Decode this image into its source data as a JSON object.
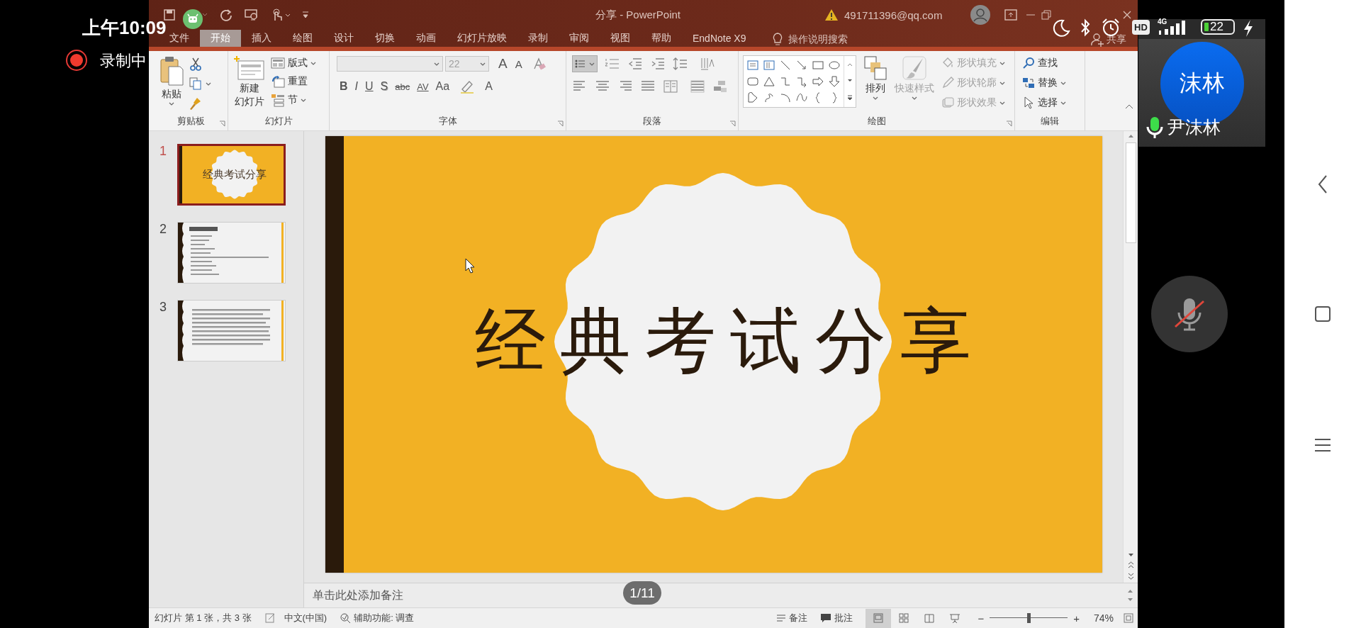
{
  "phone_status": {
    "time": "上午10:09",
    "recording": "录制中"
  },
  "title_bar": {
    "document_title": "分享  -  PowerPoint",
    "account": "491711396@qq.com"
  },
  "menu_tabs": [
    {
      "label": "文件",
      "selected": false
    },
    {
      "label": "开始",
      "selected": true
    },
    {
      "label": "插入",
      "selected": false
    },
    {
      "label": "绘图",
      "selected": false
    },
    {
      "label": "设计",
      "selected": false
    },
    {
      "label": "切换",
      "selected": false
    },
    {
      "label": "动画",
      "selected": false
    },
    {
      "label": "幻灯片放映",
      "selected": false
    },
    {
      "label": "录制",
      "selected": false
    },
    {
      "label": "审阅",
      "selected": false
    },
    {
      "label": "视图",
      "selected": false
    },
    {
      "label": "帮助",
      "selected": false
    },
    {
      "label": "EndNote X9",
      "selected": false
    }
  ],
  "tell_me": "操作说明搜索",
  "share": "共享",
  "clipboard_group": {
    "label": "剪贴板",
    "paste": "粘贴"
  },
  "slides_group": {
    "label": "幻灯片",
    "new_slide": [
      "新建",
      "幻灯片"
    ],
    "items": [
      {
        "kind": "layout",
        "label": "版式"
      },
      {
        "kind": "reset",
        "label": "重置"
      },
      {
        "kind": "section",
        "label": "节"
      }
    ]
  },
  "font_group": {
    "label": "字体",
    "font_size": "22",
    "size_buttons": [
      "A",
      "A"
    ],
    "buttons": [
      "B",
      "I",
      "U",
      "S",
      "abc",
      "AV",
      "Aa",
      "A"
    ]
  },
  "paragraph_group": {
    "label": "段落"
  },
  "drawing_group": {
    "label": "绘图",
    "tools": [
      {
        "kind": "arrange",
        "label": "排列",
        "disabled": false
      },
      {
        "kind": "quick_styles",
        "label": "快速样式",
        "disabled": true
      }
    ],
    "shape_options": [
      {
        "kind": "fill",
        "label": "形状填充",
        "disabled": true
      },
      {
        "kind": "outline",
        "label": "形状轮廓",
        "disabled": true
      },
      {
        "kind": "effects",
        "label": "形状效果",
        "disabled": true
      }
    ]
  },
  "editing_group": {
    "label": "编辑",
    "items": [
      {
        "kind": "find",
        "label": "查找"
      },
      {
        "kind": "replace",
        "label": "替换"
      },
      {
        "kind": "select",
        "label": "选择"
      }
    ]
  },
  "thumbnails": [
    {
      "number": "1",
      "selected": true,
      "kind": "title",
      "title": "经典考试分享"
    },
    {
      "number": "2",
      "selected": false,
      "kind": "list"
    },
    {
      "number": "3",
      "selected": false,
      "kind": "bullets"
    }
  ],
  "slide": {
    "title": "经典考试分享"
  },
  "notes": {
    "placeholder": "单击此处添加备注"
  },
  "page_indicator": "1/11",
  "status_bar": {
    "slide_info": "幻灯片 第 1 张，共 3 张",
    "language": "中文(中国)",
    "accessibility": "辅助功能: 调查",
    "notes_button": "备注",
    "comments_button": "批注",
    "views": [
      {
        "kind": "normal",
        "selected": true
      },
      {
        "kind": "sorter",
        "selected": false
      },
      {
        "kind": "reading",
        "selected": false
      },
      {
        "kind": "slideshow",
        "selected": false
      }
    ],
    "zoom_out": "−",
    "zoom": {
      "level": 0.5
    },
    "zoom_in": "+",
    "zoom_percent": "74%"
  },
  "call": {
    "hd": "HD",
    "network": "4G",
    "battery": "22",
    "avatar_text": "沫林",
    "name": "尹沫林",
    "mic_muted": true
  }
}
